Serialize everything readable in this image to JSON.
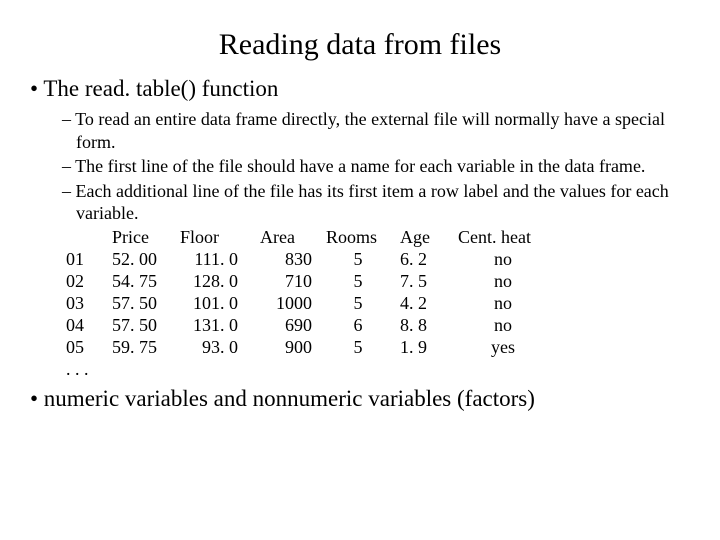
{
  "title": "Reading data from files",
  "b1": "• The read. table() function",
  "subs": {
    "s1": "– To read an entire data frame directly, the external file will normally have a special form.",
    "s2": "– The first line of the file should have a name for each variable in the data frame.",
    "s3": "– Each additional line of the file has its first item a row label and the values for each variable."
  },
  "headers": {
    "lab": "",
    "price": "Price",
    "floor": "Floor",
    "area": "Area",
    "rooms": "Rooms",
    "age": "Age",
    "cent": "Cent. heat"
  },
  "rows": [
    {
      "lab": "01",
      "price": "52. 00",
      "floor": "111. 0",
      "area": "830",
      "rooms": "5",
      "age": "6. 2",
      "cent": "no"
    },
    {
      "lab": "02",
      "price": "54. 75",
      "floor": "128. 0",
      "area": "710",
      "rooms": "5",
      "age": "7. 5",
      "cent": "no"
    },
    {
      "lab": "03",
      "price": "57. 50",
      "floor": "101. 0",
      "area": "1000",
      "rooms": "5",
      "age": "4. 2",
      "cent": "no"
    },
    {
      "lab": "04",
      "price": "57. 50",
      "floor": "131. 0",
      "area": "690",
      "rooms": "6",
      "age": "8. 8",
      "cent": "no"
    },
    {
      "lab": "05",
      "price": "59. 75",
      "floor": "93. 0",
      "area": "900",
      "rooms": "5",
      "age": "1. 9",
      "cent": "yes"
    }
  ],
  "ellipsis": ". . .",
  "b2": "• numeric variables and nonnumeric variables (factors)"
}
